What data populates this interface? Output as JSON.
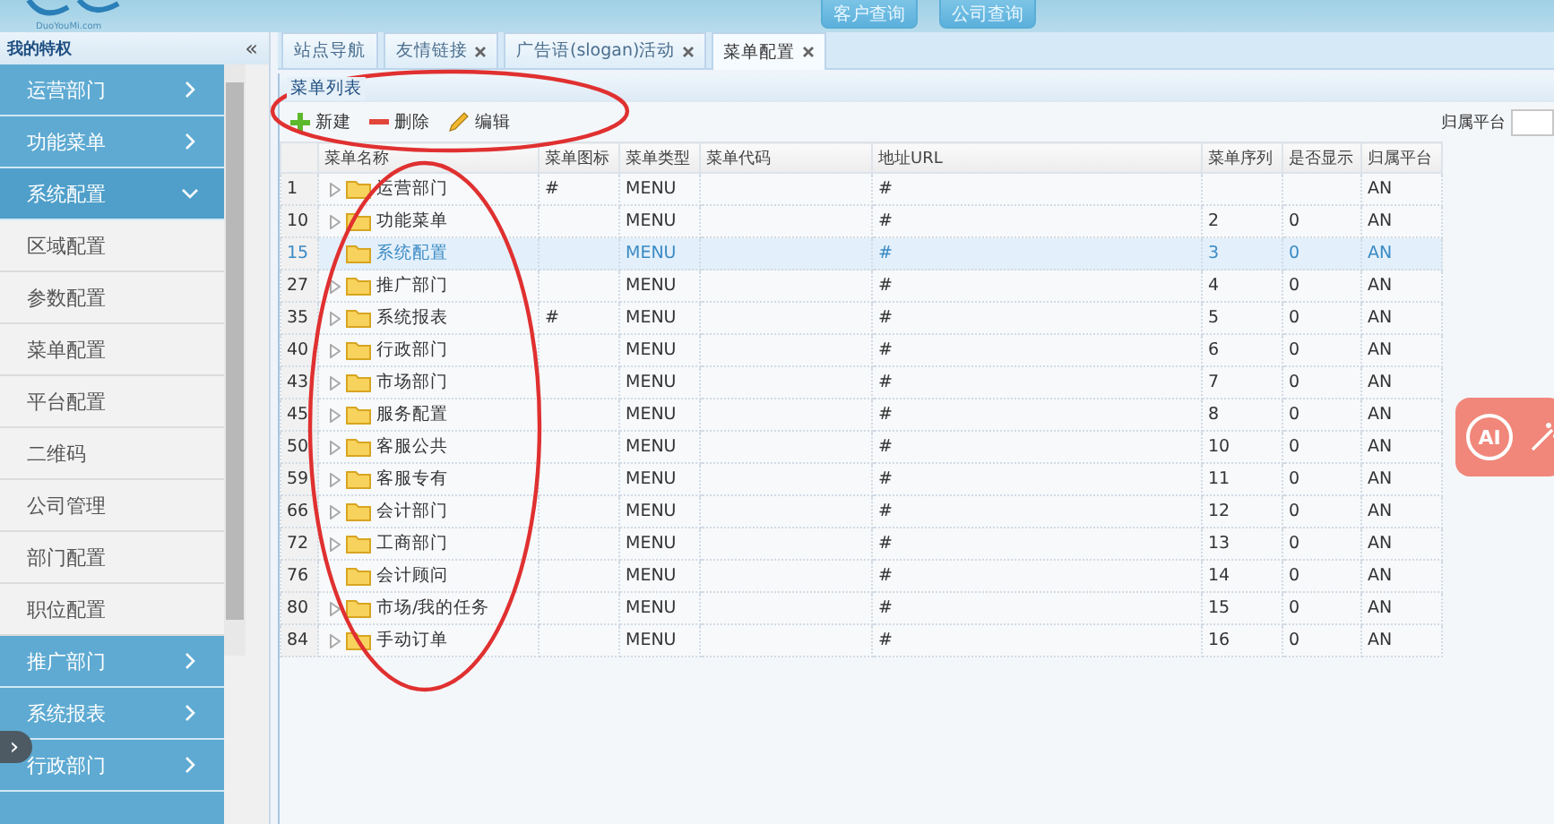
{
  "header": {
    "logo_caption": "DuoYouMi.com",
    "buttons": [
      "客户查询",
      "公司查询"
    ]
  },
  "sidebar": {
    "title": "我的特权",
    "collapse": "«",
    "items": [
      {
        "label": "运营部门",
        "expanded": false
      },
      {
        "label": "功能菜单",
        "expanded": false
      },
      {
        "label": "系统配置",
        "expanded": true,
        "children": [
          {
            "label": "区域配置"
          },
          {
            "label": "参数配置"
          },
          {
            "label": "菜单配置"
          },
          {
            "label": "平台配置"
          },
          {
            "label": "二维码"
          },
          {
            "label": "公司管理"
          },
          {
            "label": "部门配置"
          },
          {
            "label": "职位配置"
          }
        ]
      },
      {
        "label": "推广部门",
        "expanded": false
      },
      {
        "label": "系统报表",
        "expanded": false
      },
      {
        "label": "行政部门",
        "expanded": false
      }
    ],
    "handle": "›"
  },
  "tabs": [
    {
      "label": "站点导航",
      "closable": false,
      "selected": false
    },
    {
      "label": "友情链接",
      "closable": true,
      "selected": false
    },
    {
      "label": "广告语(slogan)活动",
      "closable": true,
      "selected": false
    },
    {
      "label": "菜单配置",
      "closable": true,
      "selected": true
    }
  ],
  "panel_title": "菜单列表",
  "toolbar": [
    {
      "kind": "add",
      "label": "新建"
    },
    {
      "kind": "delete",
      "label": "删除"
    },
    {
      "kind": "edit",
      "label": "编辑"
    }
  ],
  "filter": {
    "label": "归属平台"
  },
  "table": {
    "columns": [
      "菜单名称",
      "菜单图标",
      "菜单类型",
      "菜单代码",
      "地址URL",
      "菜单序列",
      "是否显示",
      "归属平台"
    ],
    "rows": [
      {
        "id": "1",
        "name": "运营部门",
        "has_children": true,
        "icon": "#",
        "type": "MENU",
        "code": "",
        "url": "#",
        "order": "",
        "show": "",
        "platform": "AN",
        "selected": false
      },
      {
        "id": "10",
        "name": "功能菜单",
        "has_children": true,
        "icon": "",
        "type": "MENU",
        "code": "",
        "url": "#",
        "order": "2",
        "show": "0",
        "platform": "AN",
        "selected": false
      },
      {
        "id": "15",
        "name": "系统配置",
        "has_children": false,
        "icon": "",
        "type": "MENU",
        "code": "",
        "url": "#",
        "order": "3",
        "show": "0",
        "platform": "AN",
        "selected": true
      },
      {
        "id": "27",
        "name": "推广部门",
        "has_children": true,
        "icon": "",
        "type": "MENU",
        "code": "",
        "url": "#",
        "order": "4",
        "show": "0",
        "platform": "AN",
        "selected": false
      },
      {
        "id": "35",
        "name": "系统报表",
        "has_children": true,
        "icon": "#",
        "type": "MENU",
        "code": "",
        "url": "#",
        "order": "5",
        "show": "0",
        "platform": "AN",
        "selected": false
      },
      {
        "id": "40",
        "name": "行政部门",
        "has_children": true,
        "icon": "",
        "type": "MENU",
        "code": "",
        "url": "#",
        "order": "6",
        "show": "0",
        "platform": "AN",
        "selected": false
      },
      {
        "id": "43",
        "name": "市场部门",
        "has_children": true,
        "icon": "",
        "type": "MENU",
        "code": "",
        "url": "#",
        "order": "7",
        "show": "0",
        "platform": "AN",
        "selected": false
      },
      {
        "id": "45",
        "name": "服务配置",
        "has_children": true,
        "icon": "",
        "type": "MENU",
        "code": "",
        "url": "#",
        "order": "8",
        "show": "0",
        "platform": "AN",
        "selected": false
      },
      {
        "id": "50",
        "name": "客服公共",
        "has_children": true,
        "icon": "",
        "type": "MENU",
        "code": "",
        "url": "#",
        "order": "10",
        "show": "0",
        "platform": "AN",
        "selected": false
      },
      {
        "id": "59",
        "name": "客服专有",
        "has_children": true,
        "icon": "",
        "type": "MENU",
        "code": "",
        "url": "#",
        "order": "11",
        "show": "0",
        "platform": "AN",
        "selected": false
      },
      {
        "id": "66",
        "name": "会计部门",
        "has_children": true,
        "icon": "",
        "type": "MENU",
        "code": "",
        "url": "#",
        "order": "12",
        "show": "0",
        "platform": "AN",
        "selected": false
      },
      {
        "id": "72",
        "name": "工商部门",
        "has_children": true,
        "icon": "",
        "type": "MENU",
        "code": "",
        "url": "#",
        "order": "13",
        "show": "0",
        "platform": "AN",
        "selected": false
      },
      {
        "id": "76",
        "name": "会计顾问",
        "has_children": false,
        "icon": "",
        "type": "MENU",
        "code": "",
        "url": "#",
        "order": "14",
        "show": "0",
        "platform": "AN",
        "selected": false
      },
      {
        "id": "80",
        "name": "市场/我的任务",
        "has_children": true,
        "icon": "",
        "type": "MENU",
        "code": "",
        "url": "#",
        "order": "15",
        "show": "0",
        "platform": "AN",
        "selected": false
      },
      {
        "id": "84",
        "name": "手动订单",
        "has_children": true,
        "icon": "",
        "type": "MENU",
        "code": "",
        "url": "#",
        "order": "16",
        "show": "0",
        "platform": "AN",
        "selected": false
      }
    ]
  },
  "ai_button": {
    "label": "AI"
  }
}
